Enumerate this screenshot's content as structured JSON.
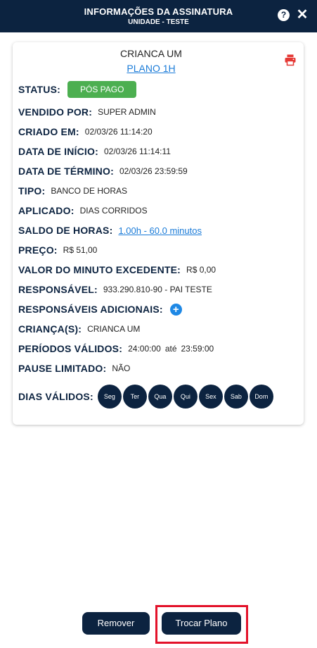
{
  "header": {
    "title": "INFORMAÇÕES DA ASSINATURA",
    "subtitle": "UNIDADE - TESTE",
    "help_icon": "?",
    "close_icon": "✕"
  },
  "card": {
    "child_name": "CRIANCA UM",
    "plan_name": "PLANO 1H",
    "print_icon": "printer-icon",
    "fields": {
      "status_label": "STATUS:",
      "status_value": "PÓS PAGO",
      "sold_by_label": "VENDIDO POR:",
      "sold_by_value": "SUPER ADMIN",
      "created_label": "CRIADO EM:",
      "created_value": "02/03/26 11:14:20",
      "start_label": "DATA DE INÍCIO:",
      "start_value": "02/03/26 11:14:11",
      "end_label": "DATA DE TÉRMINO:",
      "end_value": "02/03/26 23:59:59",
      "type_label": "TIPO:",
      "type_value": "BANCO DE HORAS",
      "applied_label": "APLICADO:",
      "applied_value": "DIAS CORRIDOS",
      "balance_label": "SALDO DE HORAS:",
      "balance_value": "1.00h - 60.0 minutos",
      "price_label": "PREÇO:",
      "price_value": "R$ 51,00",
      "excess_label": "VALOR DO MINUTO EXCEDENTE:",
      "excess_value": "R$ 0,00",
      "responsible_label": "RESPONSÁVEL:",
      "responsible_value": "933.290.810-90 - PAI TESTE",
      "additional_label": "RESPONSÁVEIS ADICIONAIS:",
      "additional_add": "+",
      "children_label": "CRIANÇA(S):",
      "children_value": "CRIANCA UM",
      "periods_label": "PERÍODOS VÁLIDOS:",
      "periods_start": "24:00:00",
      "periods_until": "até",
      "periods_end": "23:59:00",
      "pause_label": "PAUSE LIMITADO:",
      "pause_value": "NÃO",
      "days_label": "DIAS VÁLIDOS:",
      "days": [
        "Seg",
        "Ter",
        "Qua",
        "Qui",
        "Sex",
        "Sab",
        "Dom"
      ]
    }
  },
  "actions": {
    "remove_label": "Remover",
    "change_label": "Trocar Plano"
  },
  "colors": {
    "navy": "#0c2340",
    "link": "#1a7bd8",
    "status_green": "#4caf50",
    "highlight_red": "#e3122a",
    "print_red": "#e53935"
  }
}
